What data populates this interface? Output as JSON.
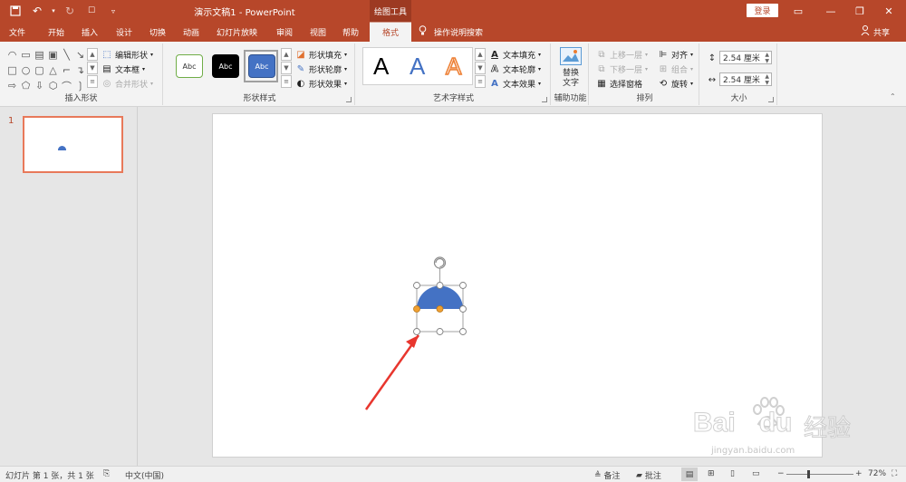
{
  "titlebar": {
    "doc_title": "演示文稿1  -  PowerPoint",
    "context_title": "绘图工具",
    "login": "登录",
    "qat": [
      "save-icon",
      "undo-icon",
      "redo-icon",
      "touch-mode-icon",
      "customize-icon"
    ]
  },
  "tabs": [
    {
      "label": "文件"
    },
    {
      "label": "开始"
    },
    {
      "label": "插入"
    },
    {
      "label": "设计"
    },
    {
      "label": "切换"
    },
    {
      "label": "动画"
    },
    {
      "label": "幻灯片放映"
    },
    {
      "label": "审阅"
    },
    {
      "label": "视图"
    },
    {
      "label": "帮助"
    },
    {
      "label": "格式"
    }
  ],
  "tell_me": "操作说明搜索",
  "share": "共享",
  "ribbon": {
    "insert_shapes": {
      "label": "插入形状",
      "edit_shape": "编辑形状",
      "text_box": "文本框",
      "merge_shapes": "合并形状"
    },
    "shape_styles": {
      "label": "形状样式",
      "sample": "Abc",
      "fill": "形状填充",
      "outline": "形状轮廓",
      "effects": "形状效果"
    },
    "wordart": {
      "label": "艺术字样式",
      "sample": "A",
      "text_fill": "文本填充",
      "text_outline": "文本轮廓",
      "text_effects": "文本效果"
    },
    "accessibility": {
      "label": "辅助功能",
      "alt_text_1": "替换",
      "alt_text_2": "文字"
    },
    "arrange": {
      "label": "排列",
      "bring_forward": "上移一层",
      "send_backward": "下移一层",
      "selection_pane": "选择窗格",
      "align": "对齐",
      "group": "组合",
      "rotate": "旋转"
    },
    "size": {
      "label": "大小",
      "height": "2.54 厘米",
      "width": "2.54 厘米"
    }
  },
  "thumbnails": {
    "slide_number": "1"
  },
  "status": {
    "slide_info": "幻灯片 第 1 张，共 1 张",
    "language": "中文(中国)",
    "notes": "备注",
    "comments": "批注",
    "zoom": "72%"
  },
  "colors": {
    "accent": "#b7472a",
    "shape_fill": "#4472c4",
    "arrow": "#e8362e",
    "handle_yellow": "#f0a030"
  },
  "watermark": {
    "brand": "Bai",
    "brand2": "du",
    "cn": "经验",
    "url": "jingyan.baidu.com"
  }
}
